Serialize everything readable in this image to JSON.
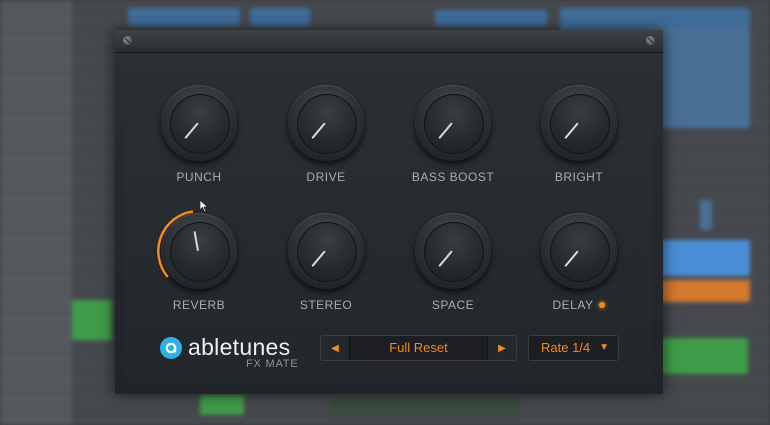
{
  "plugin": {
    "brand": "abletunes",
    "product": "FX MATE",
    "accent_color": "#f28a1c",
    "brand_color": "#2eb2e5"
  },
  "knobs": [
    {
      "id": "punch",
      "label": "PUNCH",
      "angle": -140,
      "highlight": false
    },
    {
      "id": "drive",
      "label": "DRIVE",
      "angle": -140,
      "highlight": false
    },
    {
      "id": "bass-boost",
      "label": "BASS BOOST",
      "angle": -140,
      "highlight": false
    },
    {
      "id": "bright",
      "label": "BRIGHT",
      "angle": -140,
      "highlight": false
    },
    {
      "id": "reverb",
      "label": "REVERB",
      "angle": -10,
      "highlight": true
    },
    {
      "id": "stereo",
      "label": "STEREO",
      "angle": -140,
      "highlight": false
    },
    {
      "id": "space",
      "label": "SPACE",
      "angle": -140,
      "highlight": false
    },
    {
      "id": "delay",
      "label": "DELAY",
      "angle": -140,
      "highlight": false,
      "led": true
    }
  ],
  "preset": {
    "name": "Full Reset",
    "prev_icon": "triangle-left-icon",
    "next_icon": "triangle-right-icon"
  },
  "rate": {
    "value": "Rate 1/4",
    "caret_icon": "triangle-down-icon"
  }
}
